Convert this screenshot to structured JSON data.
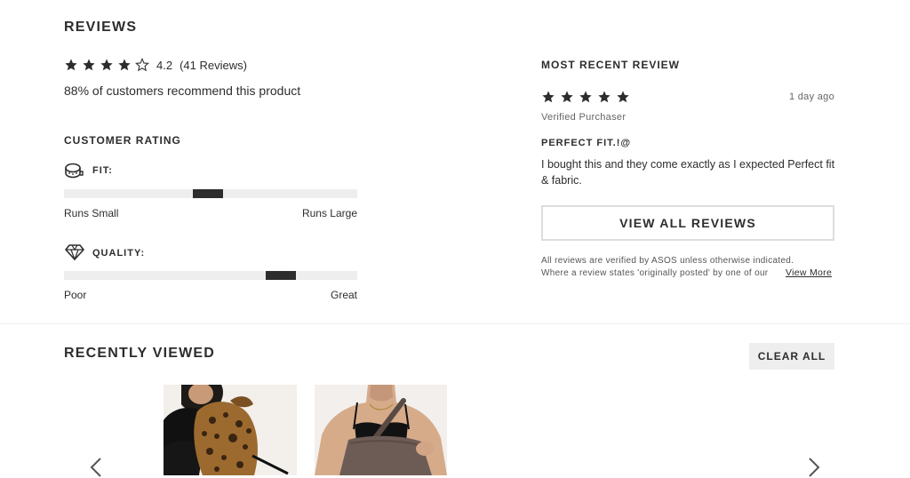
{
  "reviews": {
    "title": "REVIEWS",
    "rating": 4.2,
    "rating_text": "4.2",
    "count_text": "(41 Reviews)",
    "recommend_text": "88% of customers recommend this product",
    "customer_rating_title": "CUSTOMER RATING",
    "fit": {
      "label": "FIT:",
      "icon": "tape-measure-icon",
      "left": "Runs Small",
      "right": "Runs Large",
      "value": 0.49
    },
    "quality": {
      "label": "QUALITY:",
      "icon": "diamond-icon",
      "left": "Poor",
      "right": "Great",
      "value": 0.74
    }
  },
  "recent_review": {
    "title": "MOST RECENT REVIEW",
    "stars": 5,
    "time": "1 day ago",
    "verified": "Verified Purchaser",
    "headline": "PERFECT FIT.!@",
    "body": "I bought this and they come exactly as I expected Perfect fit & fabric.",
    "view_all_label": "VIEW ALL REVIEWS",
    "disclaimer_line1": "All reviews are verified by ASOS unless otherwise indicated.",
    "disclaimer_line2": "Where a review states 'originally posted' by one of our",
    "view_more_label": "View More"
  },
  "recently_viewed": {
    "title": "RECENTLY VIEWED",
    "clear_all_label": "CLEAR ALL",
    "prev_icon": "chevron-left-icon",
    "next_icon": "chevron-right-icon",
    "items": [
      {
        "image": "leopard-print-backpack-photo"
      },
      {
        "image": "brown-tote-bag-photo"
      }
    ]
  },
  "colors": {
    "text": "#2d2d2d",
    "bar_bg": "#eeeeee",
    "button_grey": "#eeeeee",
    "border": "#dddddd"
  }
}
